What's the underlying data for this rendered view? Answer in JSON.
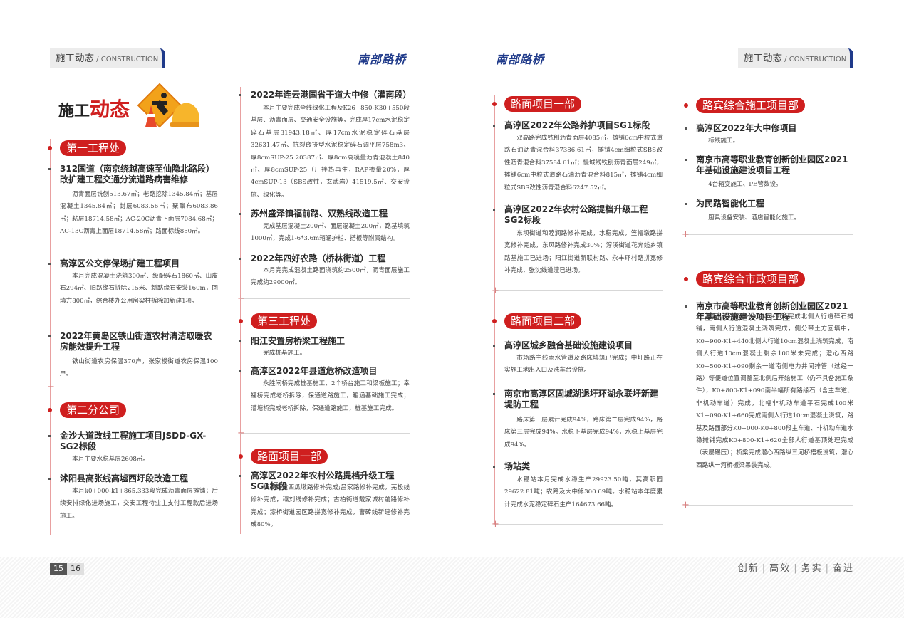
{
  "header": {
    "tab_cn": "施工动态",
    "tab_sep": " / ",
    "tab_en": "CONSTRUCTION",
    "brand": "南部路桥"
  },
  "banner": {
    "part1": "施工",
    "part2": "动态",
    "icon": "construction-worker-cone-helmet-icon"
  },
  "colors": {
    "accent_red": "#cf1f1f",
    "brand_blue": "#1f3a8a"
  },
  "col1": {
    "sect1": "第一工程处",
    "i1_title": "312国道（南京绕越高速至仙隐北路段）改扩建工程交通分流道路病害维修",
    "i1_body": "沥青面层铣刨513.67㎡；老路挖除1345.84㎡；基层混凝土1345.84㎡；封层6083.56㎡；聚酯布6083.86㎡；粘层18714.58㎡；AC-20C沥青下面层7084.68㎡；AC-13C沥青上面层18714.58㎡；路面标线850㎡。",
    "i2_title": "高淳区公交停保场扩建工程项目",
    "i2_body": "本月完成混凝土浇筑300㎡、级配碎石1860㎡、山皮石294㎡、旧路缘石拆除215米、新路缘石安装160m，回填方800㎡，综合楼办公用房梁柱拆除加新建1项。",
    "i3_title": "2022年黄岛区铁山街道农村清洁取暖农房能效提升工程",
    "i3_body": "铁山街道农房保温370户，张家楼街道农房保温100户。",
    "sect2": "第二分公司",
    "i4_title": "金沙大道改线工程施工项目JSDD-GX-SG2标段",
    "i4_body": "本月主要水稳基层2608㎡。",
    "i5_title": "沭阳县高张线高墟西圩段改造工程",
    "i5_body": "本月k0+000-k1+865.333段完成沥青面层摊铺；后续安排绿化进场施工，交安工程待业主支付工程款后进场施工。"
  },
  "col2": {
    "i1_title": "2022年连云港国省干道大中修（灌南段）",
    "i1_body": "本月主要完成全线绿化工程及K26+850-K30+550段基层、沥青面层、交通安全设施等，完成厚17cm水泥稳定碎石基层31943.18㎡、厚17cm水泥稳定碎石基层32631.47㎡、抗裂嵌挤型水泥稳定碎石调平层758m3、厚8cmSUP-25 20387㎡、厚8cm高模量沥青混凝土840㎡、厚8cmSUP-25（厂拌热再生，RAP掺量20%，厚4cmSUP-13（SBS改性，玄武岩）41519.5㎡、交安设施、绿化等。",
    "i2_title": "苏州盛泽镇福前路、双熟线改造工程",
    "i2_body": "完成基层混凝土200㎡、面层混凝土200㎡，路基填筑1000㎡，完成1-6*3.6m箱涵护栏、搭板等附属结构。",
    "i3_title": "2022年四好农路（桥林街道）工程",
    "i3_body": "本月完完成混凝土路面浇筑约2500㎡，沥青面层施工完成约29000㎡。",
    "sect3": "第三工程处",
    "i4_title": "阳江安置房桥梁工程施工",
    "i4_body": "完成桩基施工。",
    "i5_title": "高淳区2022年县道危桥改造项目",
    "i5_body": "永胜闸桥完成桩基施工、2个桥台施工和梁板施工；幸福桥完成老桥拆除，保通道路施工，箱涵基础施工完成；漕塘桥完成老桥拆除，保通道路施工，桩基施工完成。",
    "sect4": "路面项目一部",
    "i6_title": "高淳区2022年农村公路提档升级工程SG1标段",
    "i6_body": "横溪街道西瓜墩路修补完成;吕家路修补完成，芜极线修补完成，穰刘线修补完成；古柏街道戴家城村前路修补完成；漆桥街道园区路拼宽修补完成，曹砖线新建修补完成80%。"
  },
  "col3": {
    "sect1": "路面项目一部",
    "i1_title": "高淳区2022年公路养护项目SG1标段",
    "i1_body": "双高路完成铣刨沥青面层4085㎡，摊铺6cm中粒式道路石油沥青混合料37386.61㎡，摊铺4cm细粒式SBS改性沥青混合料37584.61㎡；慢城线铣刨沥青面层249㎡，摊铺6cm中粒式道路石油沥青混合料815㎡，摊铺4cm细粒式SBS改性沥青混合料6247.52㎡。",
    "i2_title": "高淳区2022年农村公路提档升级工程SG2标段",
    "i2_body": "东坝街道和睦涧路修补完成，水稳完成，笠帽墩路拼宽修补完成，东风路修补完成30%；淳溪街道花奔线乡镇路基施工已进场；阳江街道新联村路、永丰环村路拼宽修补完成，张沈线道渣已进场。",
    "sect2": "路面项目二部",
    "i3_title": "高淳区城乡融合基础设施建设项目",
    "i3_body": "市场路主线雨水管道及路床填筑已完成；中圩路正在实施工地出入口及洗车台设施。",
    "i4_title": "南京市高淳区固城湖退圩环湖永联圩新建堤防工程",
    "i4_body": "路床第一层累计完成94%，路床第二层完成94%，路床第三层完成94%。水稳下基层完成94%，水稳上基层完成94%。",
    "i5_title": "场站类",
    "i5_body": "水稳站本月完成水稳生产29923.50吨，其高职园29622.81吨；农路及大中修300.69吨。水稳站本年度累计完成水泥稳定碎石生产164673.66吨。"
  },
  "col4": {
    "sect1": "路宾综合施工项目部",
    "i1_title": "高淳区2022年大中修项目",
    "i1_body": "标线施工。",
    "i2_title": "南京市高等职业教育创新创业园区2021年基础设施建设项目工程",
    "i2_body": "4台箱变施工、PE管数设。",
    "i3_title": "为民路智能化工程",
    "i3_body": "厨具设备安装、酒店智能化施工。",
    "sect2": "路宾综合市政项目部",
    "i4_title": "南京市高等职业教育创新创业园区2021年基础设施建设项目工程",
    "i4_body": "潜心西路K0+000-K0+900完成北侧人行道碎石摊铺，南侧人行道混凝土浇筑完成，侧分带土方回填中，K0+900-K1+440北侧人行道10cm混凝土浇筑完成，南侧人行道10cm混凝土剩余100米未完成；澄心西路K0+500-K1+090剩余一道南侧电力井间排管（过经一路）等便道位置调整至北侧后开始施工（仍不具备施工条件），K0+800-K1+090南半幅所有路缘石（含主车道、非机动车道）完成，北幅非机动车道平石完成100米K1+090-K1+660完成南侧人行道10cm混凝土浇筑，路基及路面部分K0+000-K0+800段主车道、非机动车道水稳摊铺完成K0+800-K1+620全部人行道基顶处理完成（表层碾压）；桥梁完成潜心西路纵三河桥搭板浇筑，潜心西路纵一河桥板梁吊装完成。"
  },
  "footer": {
    "page_left": "15",
    "page_right": "16",
    "slogan_1": "创新",
    "slogan_2": "高效",
    "slogan_3": "务实",
    "slogan_4": "奋进",
    "sep": "|"
  }
}
